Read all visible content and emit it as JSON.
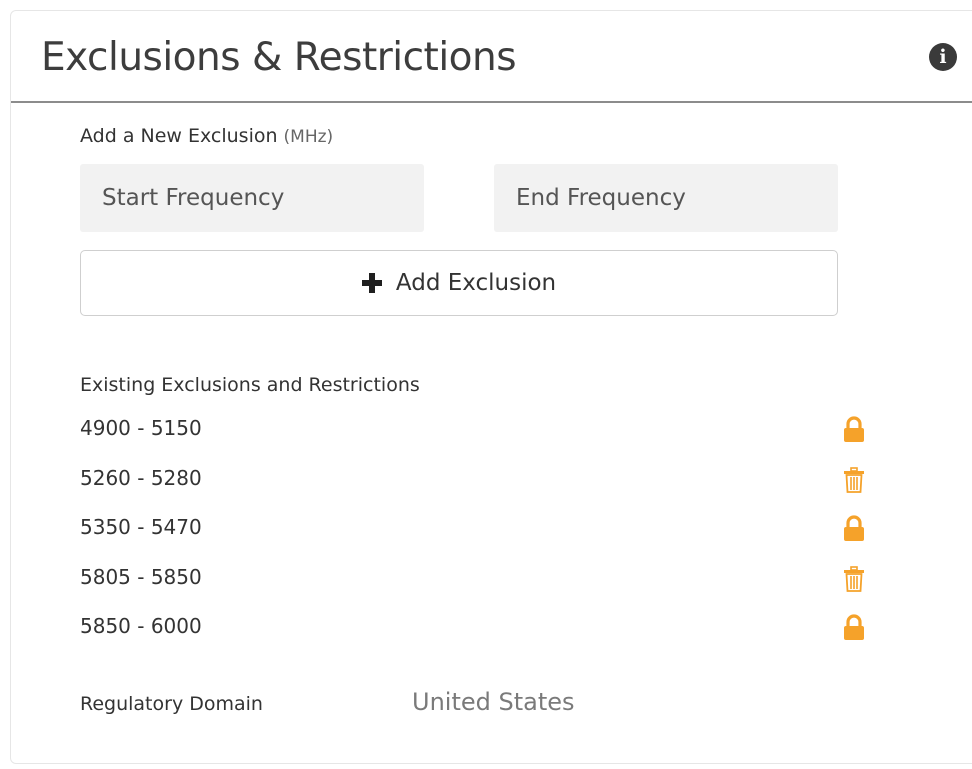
{
  "panel": {
    "title": "Exclusions & Restrictions",
    "info_icon": "info-icon",
    "info_glyph": "i"
  },
  "add_new": {
    "label": "Add a New Exclusion",
    "unit": "(MHz)",
    "start_placeholder": "Start Frequency",
    "end_placeholder": "End Frequency",
    "start_value": "",
    "end_value": "",
    "button_label": "Add Exclusion",
    "button_icon": "plus-icon"
  },
  "existing": {
    "label": "Existing Exclusions and Restrictions",
    "items": [
      {
        "range": "4900 - 5150",
        "icon": "lock-icon"
      },
      {
        "range": "5260 - 5280",
        "icon": "trash-icon"
      },
      {
        "range": "5350 - 5470",
        "icon": "lock-icon"
      },
      {
        "range": "5805 - 5850",
        "icon": "trash-icon"
      },
      {
        "range": "5850 - 6000",
        "icon": "lock-icon"
      }
    ]
  },
  "regulatory": {
    "label": "Regulatory Domain",
    "value": "United States"
  },
  "colors": {
    "accent_orange": "#f5a22a",
    "header_rule": "#8c8c8c",
    "input_background": "#f2f2f2"
  }
}
